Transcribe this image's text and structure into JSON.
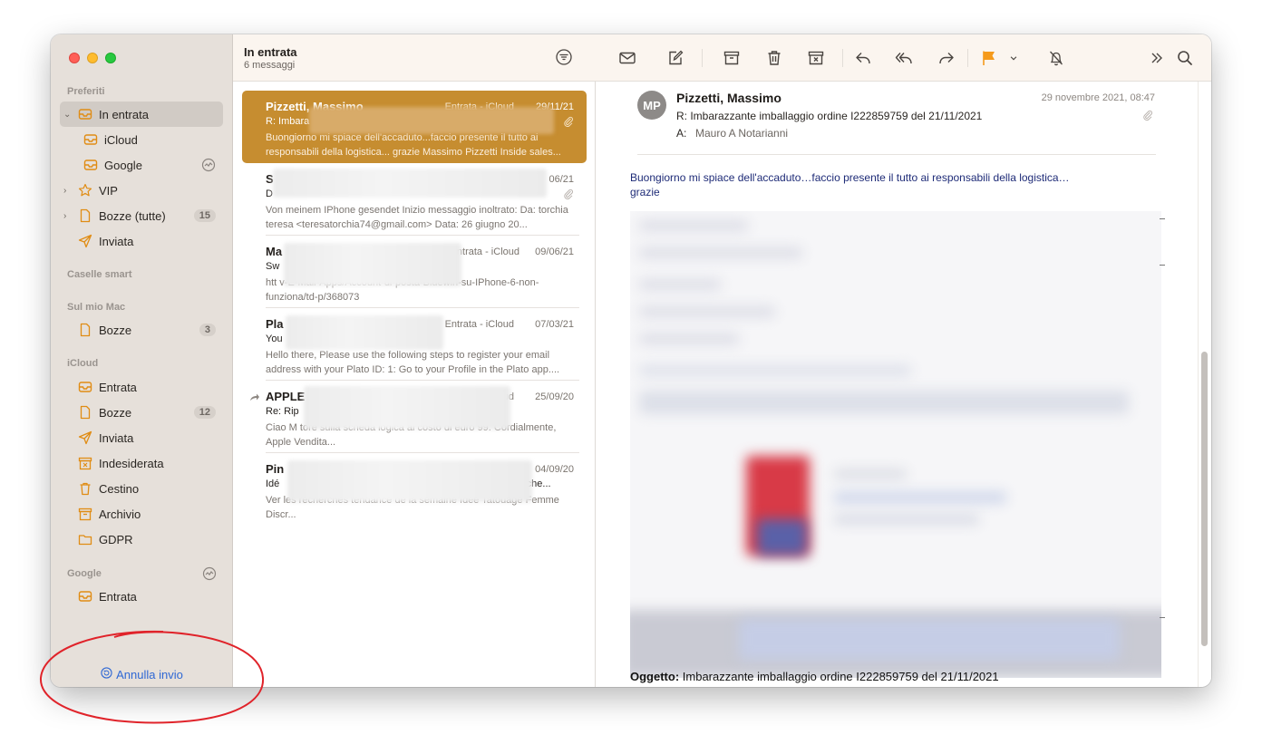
{
  "sidebar": {
    "sections": {
      "favorites": "Preferiti",
      "smart": "Caselle smart",
      "on_mac": "Sul mio Mac",
      "icloud": "iCloud",
      "google": "Google"
    },
    "favorites": [
      {
        "label": "In entrata",
        "icon": "inbox-icon",
        "selected": true,
        "expanded": true
      },
      {
        "label": "iCloud",
        "icon": "inbox-icon"
      },
      {
        "label": "Google",
        "icon": "inbox-icon",
        "activity": "activity-icon"
      },
      {
        "label": "VIP",
        "icon": "star-icon"
      },
      {
        "label": "Bozze (tutte)",
        "icon": "document-icon",
        "badge": "15"
      },
      {
        "label": "Inviata",
        "icon": "paperplane-icon"
      }
    ],
    "on_mac": [
      {
        "label": "Bozze",
        "icon": "document-icon",
        "badge": "3"
      }
    ],
    "icloud": [
      {
        "label": "Entrata",
        "icon": "inbox-icon"
      },
      {
        "label": "Bozze",
        "icon": "document-icon",
        "badge": "12"
      },
      {
        "label": "Inviata",
        "icon": "paperplane-icon"
      },
      {
        "label": "Indesiderata",
        "icon": "junk-icon"
      },
      {
        "label": "Cestino",
        "icon": "trash-icon"
      },
      {
        "label": "Archivio",
        "icon": "archive-icon"
      },
      {
        "label": "GDPR",
        "icon": "folder-icon"
      }
    ],
    "google": [
      {
        "label": "Entrata",
        "icon": "inbox-icon"
      }
    ],
    "undo_send": "Annulla invio"
  },
  "list": {
    "title": "In entrata",
    "count": "6 messaggi",
    "messages": [
      {
        "sender": "Pizzetti, Massimo",
        "mailbox": "Entrata - iCloud",
        "date": "29/11/21",
        "subject": "R: Imbara",
        "preview": "Buongiorno mi spiace dell'accaduto...faccio presente il tutto ai responsabili della logistica... grazie Massimo Pizzetti Inside sales...",
        "selected": true
      },
      {
        "sender": "S",
        "mailbox": "",
        "date": "06/21",
        "subject": "D",
        "preview": "Von meinem IPhone gesendet Inizio messaggio inoltrato: Da: torchia teresa <teresatorchia74@gmail.com> Data: 26 giugno 20..."
      },
      {
        "sender": "Ma",
        "mailbox": "ntrata - iCloud",
        "date": "09/06/21",
        "subject": "Sw",
        "preview": "htt                                                   v-E-Mail-Apps/Account-di-posta-Bluewin-su-IPhone-6-non-funziona/td-p/368073"
      },
      {
        "sender": "Pla",
        "mailbox": "Entrata - iCloud",
        "date": "07/03/21",
        "subject": "You",
        "preview": "Hello there, Please use the following steps to register your email address with your Plato ID: 1: Go to your Profile in the Plato app...."
      },
      {
        "sender": "APPLE",
        "mailbox": "oud",
        "date": "25/09/20",
        "subject": "Re: Rip",
        "preview": "Ciao M                                                tore sulla scheda logica al costo di euro 99. Cordialmente, Apple  Vendita..."
      },
      {
        "sender": "Pin",
        "mailbox": "",
        "date": "04/09/20",
        "subject": "Idé",
        "subject_tail": "rche...",
        "preview": "Ver                                                          les recherches tendance de la semaine Idée Tatouage Femme Discr..."
      }
    ]
  },
  "toolbar": {
    "buttons": [
      "envelope-icon",
      "compose-icon",
      "archive-icon",
      "trash-icon",
      "junk-icon",
      "reply-icon",
      "reply-all-icon",
      "forward-icon",
      "flag-icon",
      "chevron-down-icon",
      "bell-slash-icon",
      "chevron-double-right-icon",
      "search-icon"
    ],
    "flag_color": "#f59a1b"
  },
  "reader": {
    "avatar": "MP",
    "from": "Pizzetti, Massimo",
    "date": "29 novembre 2021, 08:47",
    "subject": "R: Imbarazzante imballaggio ordine I222859759 del 21/11/2021",
    "to_label": "A:",
    "to": "Mauro A Notarianni",
    "body_line1": "Buongiorno mi spiace dell'accaduto…faccio presente il tutto ai responsabili della logistica…",
    "body_line2": "grazie",
    "footer_label": "Oggetto:",
    "footer_value": " Imbarazzante imballaggio ordine I222859759 del 21/11/2021"
  },
  "colors": {
    "selection_accent": "#c68d30",
    "body_text": "#1e2b77",
    "annotation": "#e0232a",
    "link": "#2f68d4"
  }
}
